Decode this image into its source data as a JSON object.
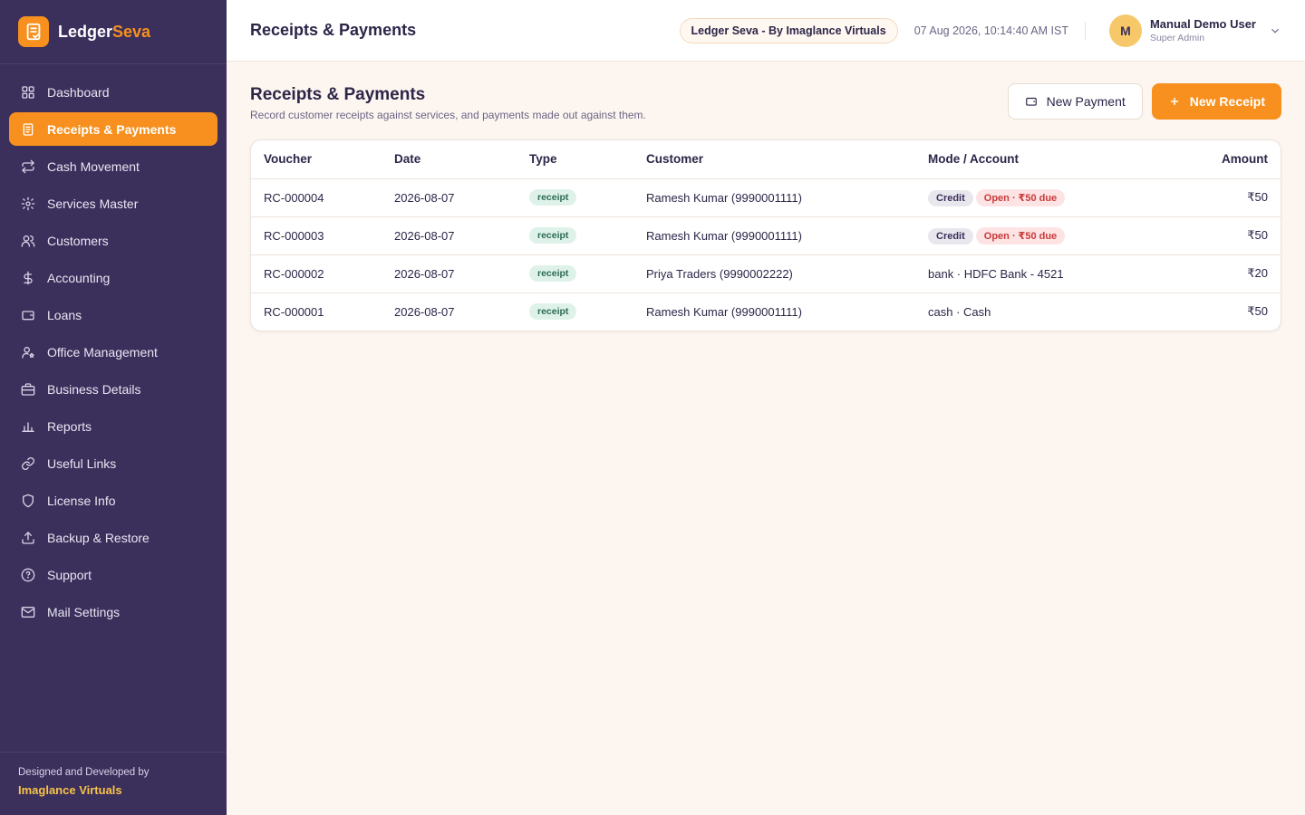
{
  "brand": {
    "name_main": "Ledger",
    "name_accent": "Seva"
  },
  "sidebar": {
    "items": [
      {
        "label": "Dashboard",
        "icon": "grid-icon",
        "active": false
      },
      {
        "label": "Receipts & Payments",
        "icon": "document-icon",
        "active": true
      },
      {
        "label": "Cash Movement",
        "icon": "arrows-icon",
        "active": false
      },
      {
        "label": "Services Master",
        "icon": "gear-icon",
        "active": false
      },
      {
        "label": "Customers",
        "icon": "users-icon",
        "active": false
      },
      {
        "label": "Accounting",
        "icon": "dollar-icon",
        "active": false
      },
      {
        "label": "Loans",
        "icon": "wallet-icon",
        "active": false
      },
      {
        "label": "Office Management",
        "icon": "user-cog-icon",
        "active": false
      },
      {
        "label": "Business Details",
        "icon": "briefcase-icon",
        "active": false
      },
      {
        "label": "Reports",
        "icon": "bar-chart-icon",
        "active": false
      },
      {
        "label": "Useful Links",
        "icon": "link-icon",
        "active": false
      },
      {
        "label": "License Info",
        "icon": "shield-icon",
        "active": false
      },
      {
        "label": "Backup & Restore",
        "icon": "upload-icon",
        "active": false
      },
      {
        "label": "Support",
        "icon": "help-circle-icon",
        "active": false
      },
      {
        "label": "Mail Settings",
        "icon": "mail-icon",
        "active": false
      }
    ],
    "footer_caption": "Designed and Developed by",
    "footer_company": "Imaglance Virtuals"
  },
  "header": {
    "title": "Receipts & Payments",
    "org_pill": "Ledger Seva - By Imaglance Virtuals",
    "clock": "07 Aug 2026, 10:14:40 AM IST",
    "user_initial": "M",
    "user_name": "Manual Demo User",
    "user_role": "Super Admin"
  },
  "page": {
    "title": "Receipts & Payments",
    "subtitle": "Record customer receipts against services, and payments made out against them.",
    "new_payment_label": "New Payment",
    "new_receipt_label": "New Receipt"
  },
  "table": {
    "columns": [
      "Voucher",
      "Date",
      "Type",
      "Customer",
      "Mode / Account",
      "Amount"
    ],
    "rows": [
      {
        "voucher": "RC-000004",
        "date": "2026-08-07",
        "type": "receipt",
        "customer": "Ramesh Kumar (9990001111)",
        "mode": "",
        "credit": "Credit",
        "due": "Open · ₹50 due",
        "amount": "₹50"
      },
      {
        "voucher": "RC-000003",
        "date": "2026-08-07",
        "type": "receipt",
        "customer": "Ramesh Kumar (9990001111)",
        "mode": "",
        "credit": "Credit",
        "due": "Open · ₹50 due",
        "amount": "₹50"
      },
      {
        "voucher": "RC-000002",
        "date": "2026-08-07",
        "type": "receipt",
        "customer": "Priya Traders (9990002222)",
        "mode": "bank · HDFC Bank - 4521",
        "credit": "",
        "due": "",
        "amount": "₹20"
      },
      {
        "voucher": "RC-000001",
        "date": "2026-08-07",
        "type": "receipt",
        "customer": "Ramesh Kumar (9990001111)",
        "mode": "cash · Cash",
        "credit": "",
        "due": "",
        "amount": "₹50"
      }
    ]
  },
  "colors": {
    "sidebar_bg": "#3b2f5c",
    "accent": "#f7901e",
    "page_bg": "#fdf6f0"
  }
}
